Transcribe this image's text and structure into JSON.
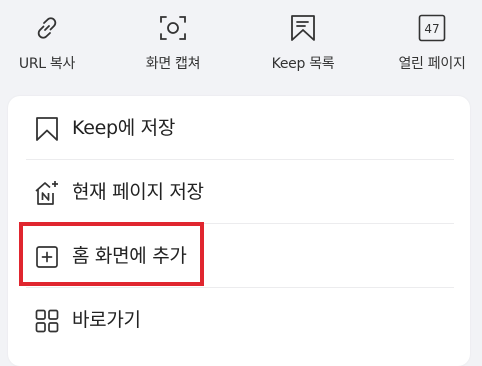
{
  "quick_actions": [
    {
      "label": "URL 복사",
      "icon": "link-icon"
    },
    {
      "label": "화면 캡쳐",
      "icon": "screen-capture-icon"
    },
    {
      "label": "Keep 목록",
      "icon": "keep-list-icon"
    },
    {
      "label": "열린 페이지",
      "icon": "open-pages-icon",
      "count": "47"
    }
  ],
  "menu": {
    "items": [
      {
        "label": "Keep에 저장",
        "icon": "bookmark-icon"
      },
      {
        "label": "현재 페이지 저장",
        "icon": "save-page-icon"
      },
      {
        "label": "홈 화면에 추가",
        "icon": "add-square-icon"
      },
      {
        "label": "바로가기",
        "icon": "grid-icon"
      }
    ]
  },
  "colors": {
    "background": "#f2f3f6",
    "card": "#ffffff",
    "highlight": "#e0262f",
    "icon": "#333333"
  }
}
